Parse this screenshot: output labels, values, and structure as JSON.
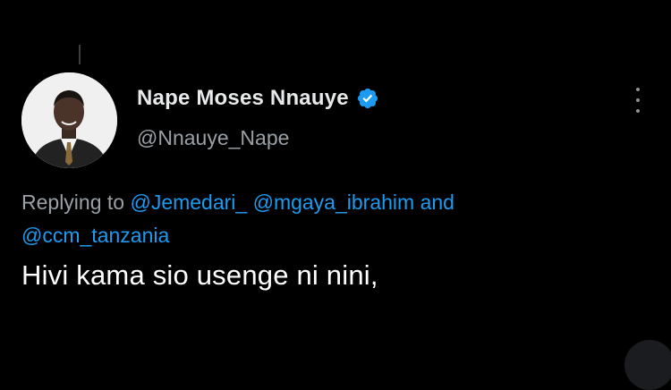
{
  "tweet": {
    "display_name": "Nape Moses Nnauye",
    "handle": "@Nnauye_Nape",
    "verified": true,
    "replying_prefix": "Replying to",
    "mentions": [
      "@Jemedari_",
      "@mgaya_ibrahim",
      "@ccm_tanzania"
    ],
    "mention_joiner": "and",
    "text": "Hivi kama sio usenge ni nini,"
  },
  "icons": {
    "verified": "verified-badge-icon",
    "more": "more-options-icon"
  },
  "colors": {
    "background": "#000000",
    "text_primary": "#ffffff",
    "text_secondary": "#9aa0a6",
    "link": "#1d9bf0",
    "verified": "#1d9bf0"
  }
}
